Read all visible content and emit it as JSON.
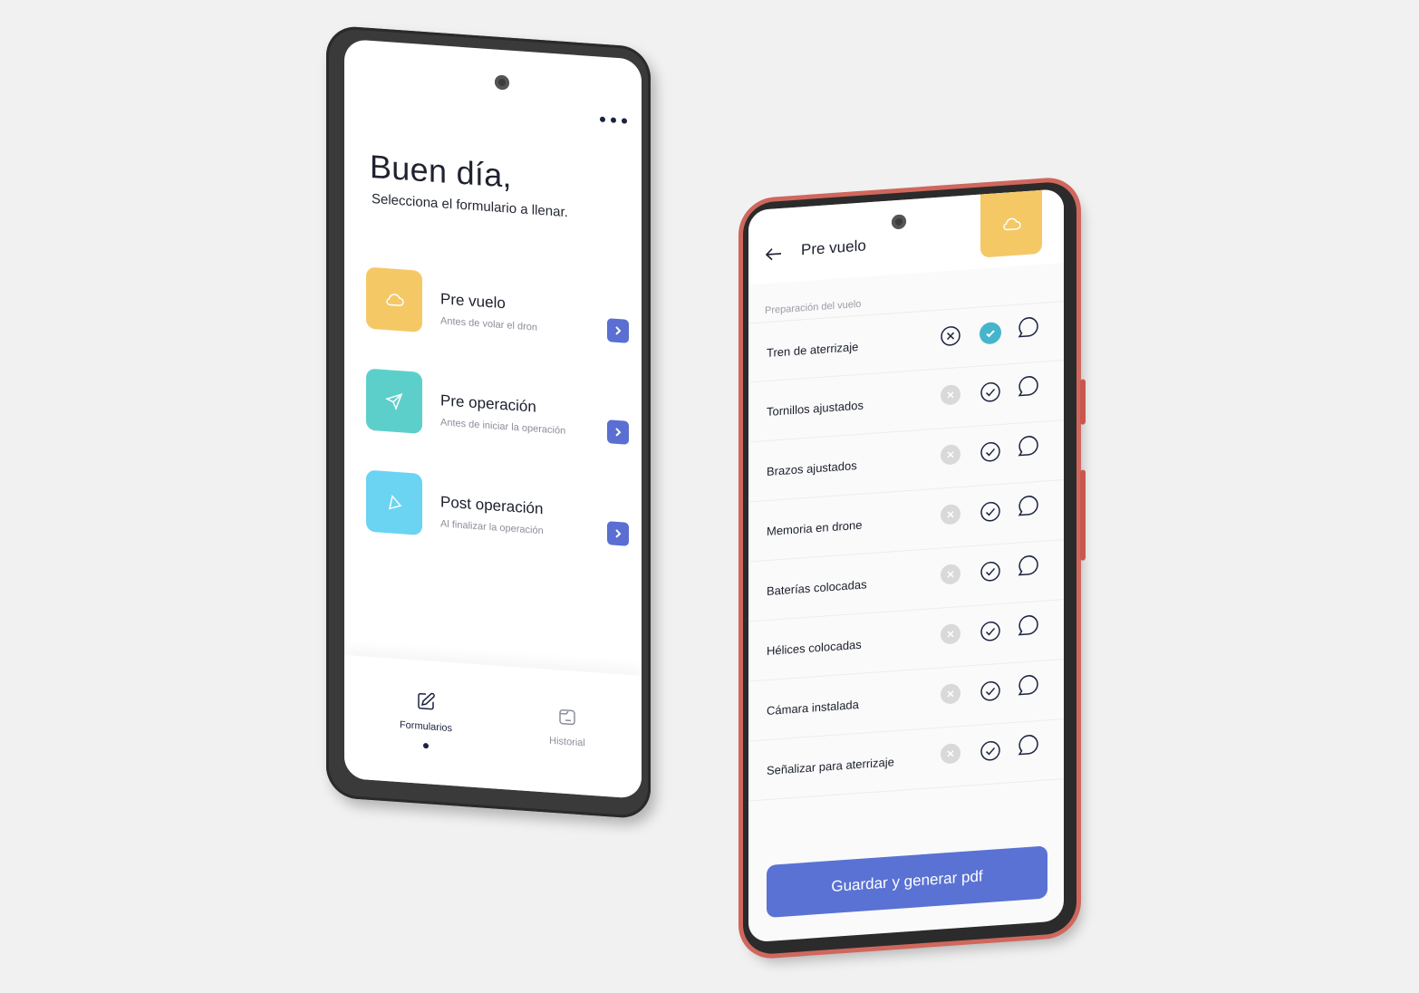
{
  "home": {
    "greeting": "Buen día,",
    "subtitle": "Selecciona el formulario a llenar.",
    "cards": [
      {
        "title": "Pre vuelo",
        "desc": "Antes de volar el dron",
        "color": "#f5c866",
        "icon": "cloud-icon"
      },
      {
        "title": "Pre operación",
        "desc": "Antes de iniciar la operación",
        "color": "#5dcfcb",
        "icon": "send-icon"
      },
      {
        "title": "Post operación",
        "desc": "Al finalizar la operación",
        "color": "#6ad4f2",
        "icon": "navigation-icon"
      }
    ],
    "nav": {
      "formularios": "Formularios",
      "historial": "Historial"
    }
  },
  "checklist": {
    "title": "Pre vuelo",
    "section": "Preparación del vuelo",
    "items": [
      {
        "label": "Tren de aterrizaje",
        "status": "checked"
      },
      {
        "label": "Tornillos ajustados",
        "status": "pending"
      },
      {
        "label": "Brazos ajustados",
        "status": "pending"
      },
      {
        "label": "Memoria en drone",
        "status": "pending"
      },
      {
        "label": "Baterías colocadas",
        "status": "pending"
      },
      {
        "label": "Hélices colocadas",
        "status": "pending"
      },
      {
        "label": "Cámara instalada",
        "status": "pending"
      },
      {
        "label": "Señalizar para aterrizaje",
        "status": "pending"
      }
    ],
    "save_label": "Guardar y generar pdf"
  },
  "colors": {
    "accent": "#5a72d3",
    "yellow": "#f5c866",
    "teal": "#5dcfcb",
    "sky": "#6ad4f2",
    "check": "#46b5cc",
    "phone_red": "#d0675d"
  }
}
